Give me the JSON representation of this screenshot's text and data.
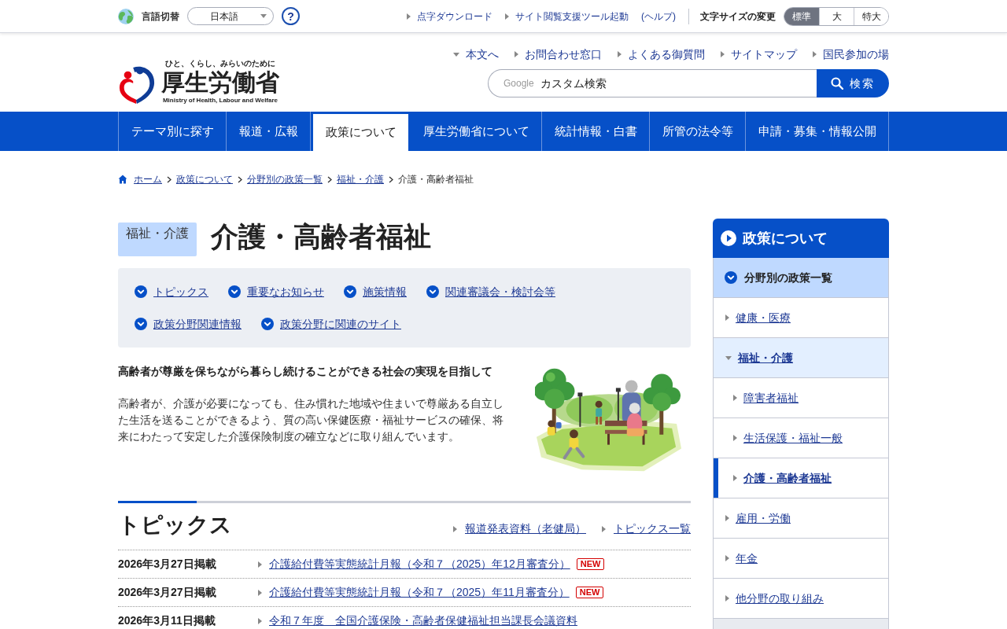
{
  "top_bar": {
    "language": {
      "label": "言語切替",
      "value": "日本語"
    },
    "help": "?",
    "links": [
      {
        "label": "点字ダウンロード",
        "kind": "arrow"
      },
      {
        "label": "サイト閲覧支援ツール起動",
        "kind": "arrow"
      },
      {
        "label": "(ヘルプ)",
        "kind": "plain"
      }
    ],
    "text_size": {
      "label": "文字サイズの変更",
      "options": [
        {
          "label": "標準",
          "selected": true
        },
        {
          "label": "大",
          "selected": false
        },
        {
          "label": "特大",
          "selected": false
        }
      ]
    }
  },
  "header": {
    "logo": {
      "tagline": "ひと、くらし、みらいのために",
      "name": "厚生労働省",
      "english": "Ministry of Health, Labour and Welfare"
    },
    "links": [
      {
        "label": "本文へ",
        "kind": "down"
      },
      {
        "label": "お問合わせ窓口",
        "kind": "right"
      },
      {
        "label": "よくある御質問",
        "kind": "right"
      },
      {
        "label": "サイトマップ",
        "kind": "right"
      },
      {
        "label": "国民参加の場",
        "kind": "right"
      }
    ],
    "search": {
      "brand": "Google",
      "placeholder": "カスタム検索",
      "button": "検索"
    }
  },
  "nav": [
    {
      "label": "テーマ別に探す",
      "selected": false
    },
    {
      "label": "報道・広報",
      "selected": false
    },
    {
      "label": "政策について",
      "selected": true
    },
    {
      "label": "厚生労働省について",
      "selected": false
    },
    {
      "label": "統計情報・白書",
      "selected": false
    },
    {
      "label": "所管の法令等",
      "selected": false
    },
    {
      "label": "申請・募集・情報公開",
      "selected": false
    }
  ],
  "breadcrumb": [
    {
      "label": "ホーム",
      "kind": "home"
    },
    {
      "label": "政策について",
      "kind": "link"
    },
    {
      "label": "分野別の政策一覧",
      "kind": "link"
    },
    {
      "label": "福祉・介護",
      "kind": "link"
    },
    {
      "label": "介護・高齢者福祉",
      "kind": "current"
    }
  ],
  "page": {
    "category": "福祉・介護",
    "title": "介護・高齢者福祉",
    "anchors": [
      "トピックス",
      "重要なお知らせ",
      "施策情報",
      "関連審議会・検討会等",
      "政策分野関連情報",
      "政策分野に関連のサイト"
    ],
    "lead": "高齢者が尊厳を保ちながら暮らし続けることができる社会の実現を目指して",
    "body": "高齢者が、介護が必要になっても、住み慣れた地域や住まいで尊厳ある自立した生活を送ることができるよう、質の高い保健医療・福祉サービスの確保、将来にわたって安定した介護保険制度の確立などに取り組んでいます。"
  },
  "topics": {
    "title": "トピックス",
    "links": [
      "報道発表資料（老健局）",
      "トピックス一覧"
    ],
    "rows": [
      {
        "date": "2026年3月27日掲載",
        "title": "介護給付費等実態統計月報（令和７（2025）年12月審査分）",
        "badge": "NEW"
      },
      {
        "date": "2026年3月27日掲載",
        "title": "介護給付費等実態統計月報（令和７（2025）年11月審査分）",
        "badge": "NEW"
      },
      {
        "date": "2026年3月11日掲載",
        "title": "令和７年度　全国介護保険・高齢者保健福祉担当課長会議資料"
      }
    ]
  },
  "sidebar": {
    "title": "政策について",
    "section": "分野別の政策一覧",
    "items": [
      {
        "label": "健康・医療",
        "expanded": false,
        "selected": false
      },
      {
        "label": "福祉・介護",
        "expanded": true,
        "selected": false,
        "children": [
          {
            "label": "障害者福祉",
            "selected": false
          },
          {
            "label": "生活保護・福祉一般",
            "selected": false
          },
          {
            "label": "介護・高齢者福祉",
            "selected": true
          }
        ]
      },
      {
        "label": "雇用・労働",
        "expanded": false,
        "selected": false
      },
      {
        "label": "年金",
        "expanded": false,
        "selected": false
      },
      {
        "label": "他分野の取り組み",
        "expanded": false,
        "selected": false
      }
    ]
  }
}
